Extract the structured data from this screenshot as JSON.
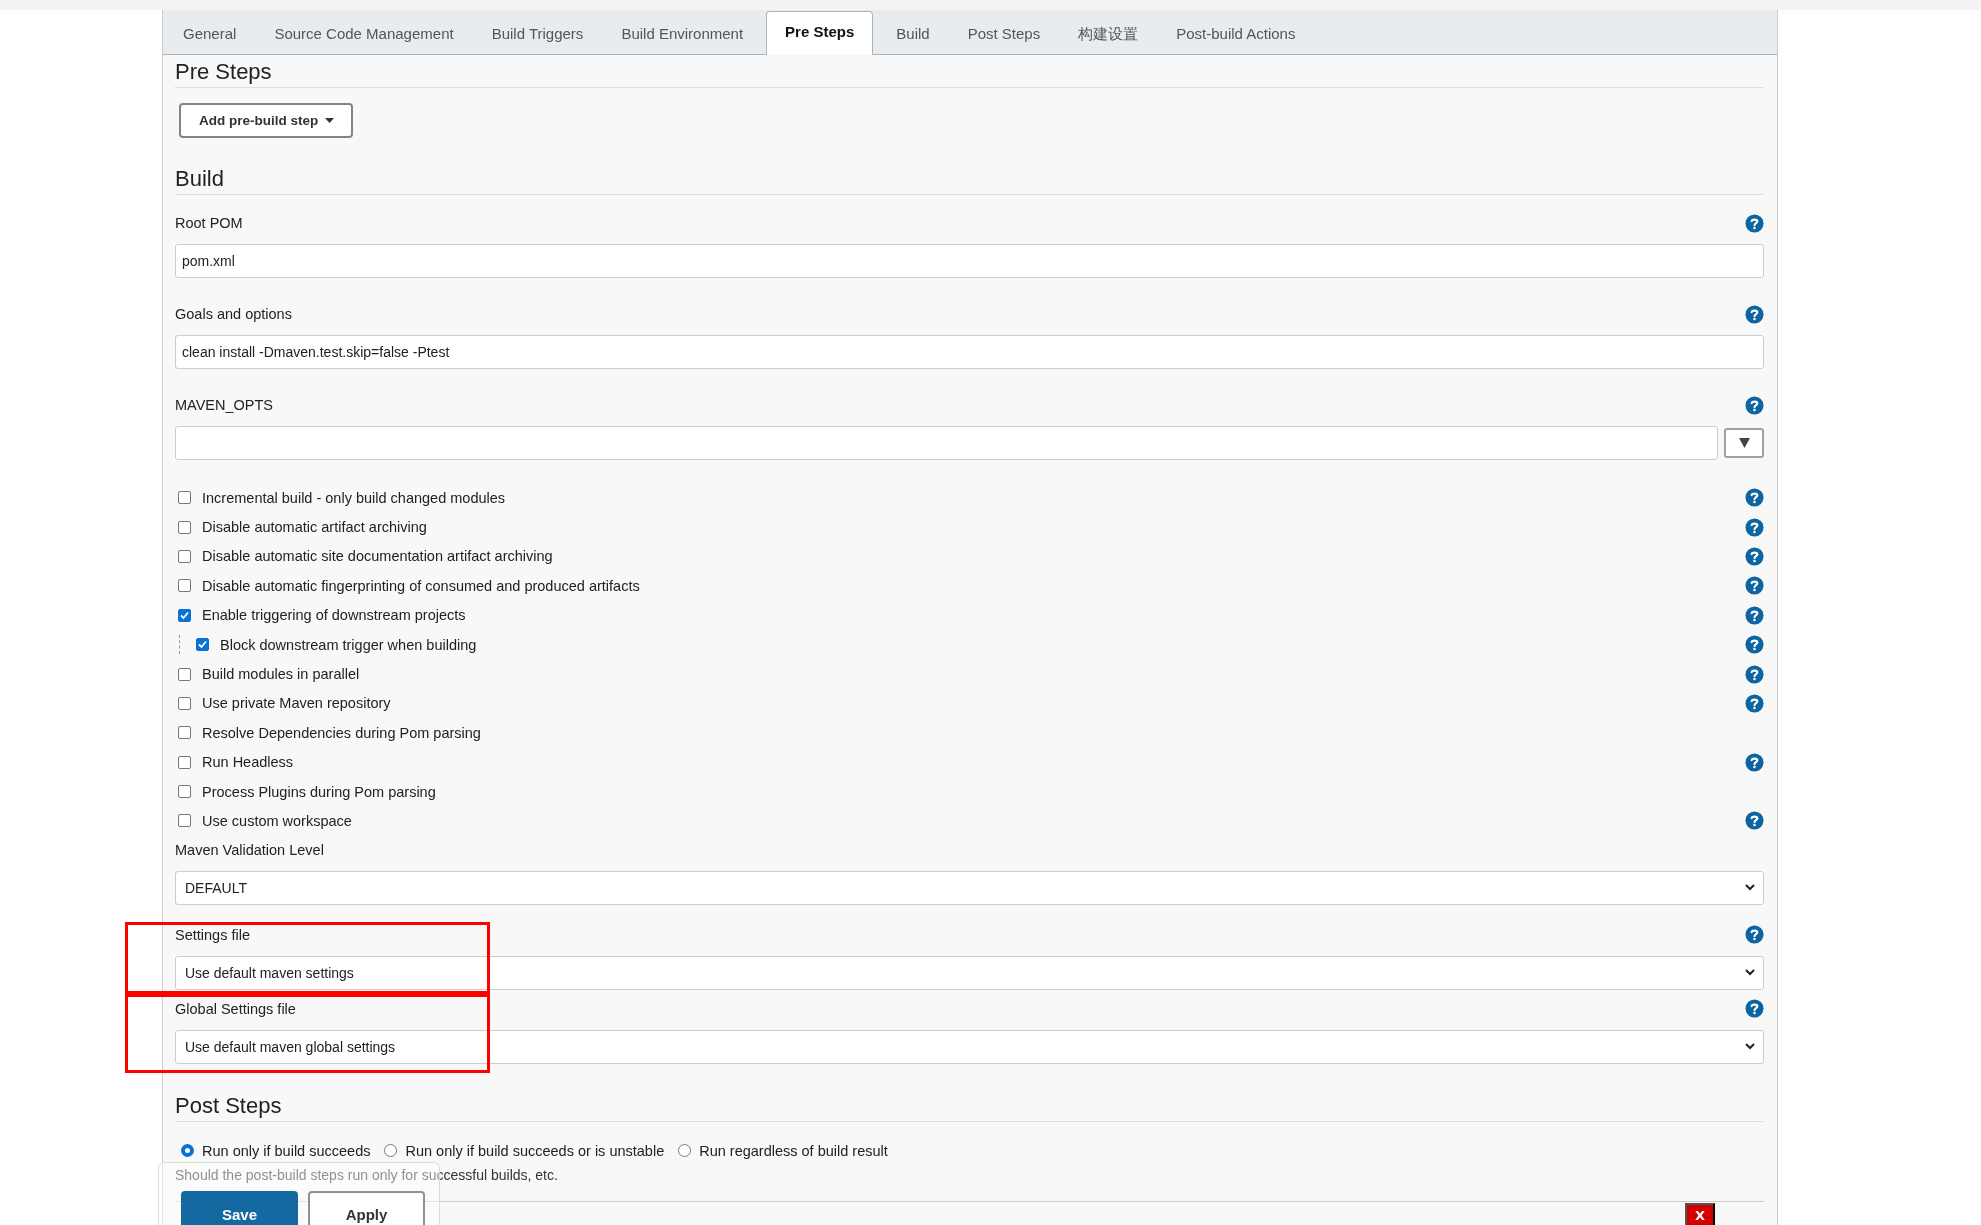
{
  "tabs": [
    {
      "label": "General",
      "selected": false
    },
    {
      "label": "Source Code Management",
      "selected": false
    },
    {
      "label": "Build Triggers",
      "selected": false
    },
    {
      "label": "Build Environment",
      "selected": false
    },
    {
      "label": "Pre Steps",
      "selected": true
    },
    {
      "label": "Build",
      "selected": false
    },
    {
      "label": "Post Steps",
      "selected": false
    },
    {
      "label": "构建设置",
      "selected": false
    },
    {
      "label": "Post-build Actions",
      "selected": false
    }
  ],
  "pre_steps": {
    "heading": "Pre Steps",
    "add_button": "Add pre-build step"
  },
  "build": {
    "heading": "Build",
    "fields": [
      {
        "kind": "text",
        "label": "Root POM",
        "value": "pom.xml",
        "help": true
      },
      {
        "kind": "text",
        "label": "Goals and options",
        "value": "clean install -Dmaven.test.skip=false -Ptest",
        "help": true
      },
      {
        "kind": "combo",
        "label": "MAVEN_OPTS",
        "help": true
      }
    ],
    "options": [
      {
        "label": "Incremental build - only build changed modules",
        "checked": false,
        "help": true
      },
      {
        "label": "Disable automatic artifact archiving",
        "checked": false,
        "help": true
      },
      {
        "label": "Disable automatic site documentation artifact archiving",
        "checked": false,
        "help": true
      },
      {
        "label": "Disable automatic fingerprinting of consumed and produced artifacts",
        "checked": false,
        "help": true
      },
      {
        "label": "Enable triggering of downstream projects",
        "checked": true,
        "help": true,
        "children": [
          {
            "label": "Block downstream trigger when building",
            "checked": true,
            "help": true
          }
        ]
      },
      {
        "label": "Build modules in parallel",
        "checked": false,
        "help": true
      },
      {
        "label": "Use private Maven repository",
        "checked": false,
        "help": true
      },
      {
        "label": "Resolve Dependencies during Pom parsing",
        "checked": false,
        "help": false
      },
      {
        "label": "Run Headless",
        "checked": false,
        "help": true
      },
      {
        "label": "Process Plugins during Pom parsing",
        "checked": false,
        "help": false
      },
      {
        "label": "Use custom workspace",
        "checked": false,
        "help": true
      }
    ],
    "selects": [
      {
        "label": "Maven Validation Level",
        "value": "DEFAULT",
        "help": false,
        "highlighted": false
      },
      {
        "label": "Settings file",
        "value": "Use default maven settings",
        "help": true,
        "highlighted": true
      },
      {
        "label": "Global Settings file",
        "value": "Use default maven global settings",
        "help": true,
        "highlighted": true
      }
    ]
  },
  "post_steps": {
    "heading": "Post Steps",
    "radios": [
      {
        "label": "Run only if build succeeds",
        "selected": true
      },
      {
        "label": "Run only if build succeeds or is unstable",
        "selected": false
      },
      {
        "label": "Run regardless of build result",
        "selected": false
      }
    ],
    "description": "Should the post-build steps run only for successful builds, etc.",
    "delete_button": "X"
  },
  "actions": [
    {
      "label": "Save",
      "kind": "primary"
    },
    {
      "label": "Apply",
      "kind": "secondary"
    }
  ]
}
